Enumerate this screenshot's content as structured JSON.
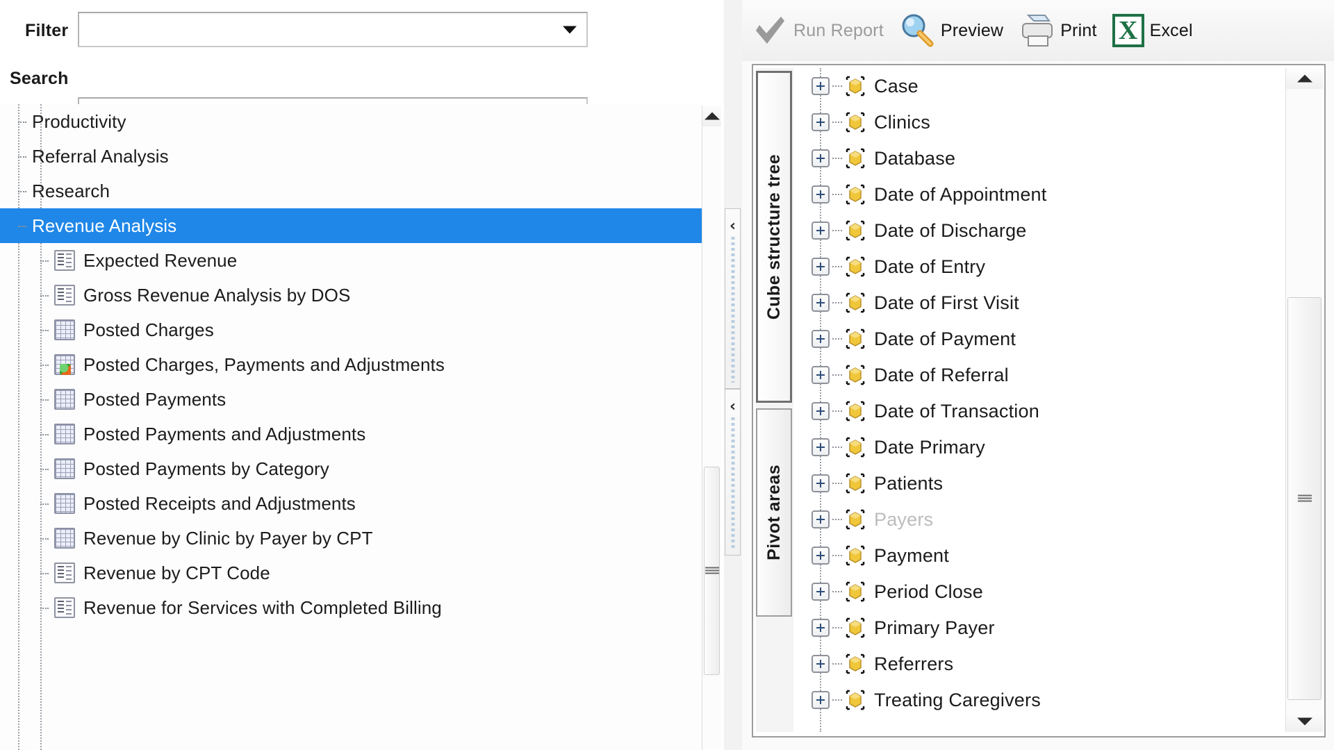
{
  "left_pane": {
    "filter": {
      "label": "Filter",
      "value": "",
      "placeholder": "",
      "icon": "chevron-down-icon"
    },
    "search": {
      "label": "Search",
      "value": "",
      "placeholder": ""
    },
    "report_tree": {
      "selected_label": "Revenue Analysis",
      "selection_color": "#1f87e8",
      "items": [
        {
          "label": "Productivity",
          "level": 0,
          "icon": "none",
          "selected": false
        },
        {
          "label": "Referral Analysis",
          "level": 0,
          "icon": "none",
          "selected": false
        },
        {
          "label": "Research",
          "level": 0,
          "icon": "none",
          "selected": false
        },
        {
          "label": "Revenue Analysis",
          "level": 0,
          "icon": "none",
          "selected": true
        },
        {
          "label": "Expected Revenue",
          "level": 1,
          "icon": "report-icon",
          "selected": false
        },
        {
          "label": "Gross Revenue Analysis by DOS",
          "level": 1,
          "icon": "report-icon",
          "selected": false
        },
        {
          "label": "Posted Charges",
          "level": 1,
          "icon": "grid-icon",
          "selected": false
        },
        {
          "label": "Posted Charges, Payments and Adjustments",
          "level": 1,
          "icon": "grid-badge-icon",
          "selected": false
        },
        {
          "label": "Posted Payments",
          "level": 1,
          "icon": "grid-icon",
          "selected": false
        },
        {
          "label": "Posted Payments and Adjustments",
          "level": 1,
          "icon": "grid-icon",
          "selected": false
        },
        {
          "label": "Posted Payments by Category",
          "level": 1,
          "icon": "grid-icon",
          "selected": false
        },
        {
          "label": "Posted Receipts and Adjustments",
          "level": 1,
          "icon": "grid-icon",
          "selected": false
        },
        {
          "label": "Revenue by Clinic by Payer by CPT",
          "level": 1,
          "icon": "grid-icon",
          "selected": false
        },
        {
          "label": "Revenue by CPT Code",
          "level": 1,
          "icon": "report-icon",
          "selected": false
        },
        {
          "label": "Revenue for Services with Completed Billing",
          "level": 1,
          "icon": "report-icon",
          "selected": false
        }
      ]
    }
  },
  "splitter": {
    "collapse_icon_top": "‹",
    "collapse_icon_bottom": "‹"
  },
  "right_pane": {
    "toolbar": {
      "items": [
        {
          "label": "Run Report",
          "accel": "R",
          "icon": "checkmark-icon",
          "disabled": true
        },
        {
          "label": "Preview",
          "accel": "v",
          "icon": "magnifier-icon",
          "disabled": false
        },
        {
          "label": "Print",
          "accel": "P",
          "icon": "printer-icon",
          "disabled": false
        },
        {
          "label": "Excel",
          "accel": "E",
          "icon": "excel-icon",
          "disabled": false
        }
      ],
      "excel_glyph": "X"
    },
    "tabs": [
      {
        "label": "Cube structure tree",
        "active": true
      },
      {
        "label": "Pivot areas",
        "active": false
      }
    ],
    "cube_tree": {
      "items": [
        {
          "label": "Case",
          "icon": "cube-icon",
          "disabled": false
        },
        {
          "label": "Clinics",
          "icon": "cube-icon",
          "disabled": false
        },
        {
          "label": "Database",
          "icon": "cube-icon",
          "disabled": false
        },
        {
          "label": "Date of Appointment",
          "icon": "cube-icon",
          "disabled": false
        },
        {
          "label": "Date of Discharge",
          "icon": "cube-icon",
          "disabled": false
        },
        {
          "label": "Date of Entry",
          "icon": "cube-icon",
          "disabled": false
        },
        {
          "label": "Date of First Visit",
          "icon": "cube-icon",
          "disabled": false
        },
        {
          "label": "Date of Payment",
          "icon": "cube-icon",
          "disabled": false
        },
        {
          "label": "Date of Referral",
          "icon": "cube-icon",
          "disabled": false
        },
        {
          "label": "Date of Transaction",
          "icon": "cube-icon",
          "disabled": false
        },
        {
          "label": "Date Primary",
          "icon": "cube-icon",
          "disabled": false
        },
        {
          "label": "Patients",
          "icon": "cube-icon",
          "disabled": false
        },
        {
          "label": "Payers",
          "icon": "cube-icon",
          "disabled": true
        },
        {
          "label": "Payment",
          "icon": "cube-icon",
          "disabled": false
        },
        {
          "label": "Period Close",
          "icon": "cube-icon",
          "disabled": false
        },
        {
          "label": "Primary Payer",
          "icon": "cube-icon",
          "disabled": false
        },
        {
          "label": "Referrers",
          "icon": "cube-icon",
          "disabled": false
        },
        {
          "label": "Treating Caregivers",
          "icon": "cube-icon",
          "disabled": false
        }
      ]
    }
  }
}
